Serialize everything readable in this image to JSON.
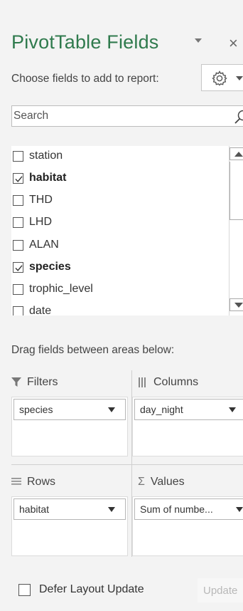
{
  "pane": {
    "title": "PivotTable Fields",
    "choose_label": "Choose fields to add to report:",
    "drag_label": "Drag fields between areas below:"
  },
  "search": {
    "placeholder": "Search"
  },
  "fields": [
    {
      "label": "station",
      "checked": false
    },
    {
      "label": "habitat",
      "checked": true
    },
    {
      "label": "THD",
      "checked": false
    },
    {
      "label": "LHD",
      "checked": false
    },
    {
      "label": "ALAN",
      "checked": false
    },
    {
      "label": "species",
      "checked": true
    },
    {
      "label": "trophic_level",
      "checked": false
    },
    {
      "label": "date",
      "checked": false
    }
  ],
  "areas": {
    "filters": {
      "label": "Filters",
      "items": [
        "species"
      ]
    },
    "columns": {
      "label": "Columns",
      "items": [
        "day_night"
      ]
    },
    "rows": {
      "label": "Rows",
      "items": [
        "habitat"
      ]
    },
    "values": {
      "label": "Values",
      "items": [
        "Sum of numbe..."
      ]
    }
  },
  "footer": {
    "defer_label": "Defer Layout Update",
    "defer_checked": false,
    "update_label": "Update"
  },
  "colors": {
    "title": "#2f7a4d",
    "pane_background": "#f3f3f3"
  },
  "icons": {
    "title_dropdown": "chevron-down-icon",
    "close": "close-icon",
    "settings": "gear-icon",
    "search": "search-icon",
    "filters": "funnel-icon",
    "columns": "columns-icon",
    "rows": "rows-icon",
    "values": "sigma-icon"
  },
  "glyphs": {
    "close": "×",
    "sigma": "Σ"
  }
}
